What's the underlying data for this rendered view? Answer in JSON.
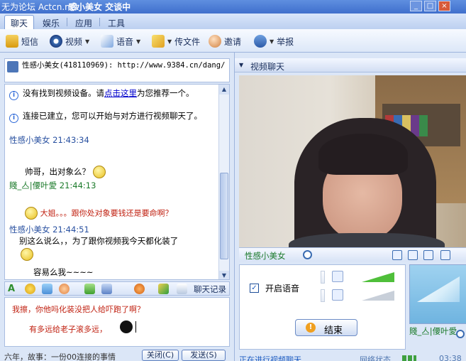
{
  "window": {
    "watermark": "无为论坛 Actcn.net",
    "title": "感小美女 交谈中",
    "controls": {
      "minimize": "_",
      "maximize": "□",
      "close": "×"
    }
  },
  "menu": {
    "tabs": [
      {
        "label": "聊天"
      },
      {
        "label": "娱乐"
      },
      {
        "label": "应用"
      },
      {
        "label": "工具"
      }
    ]
  },
  "toolbar": {
    "items": [
      {
        "label": "短信",
        "icon": "sms-icon"
      },
      {
        "label": "视频",
        "icon": "video-icon"
      },
      {
        "label": "语音",
        "icon": "voice-icon"
      },
      {
        "label": "传文件",
        "icon": "file-transfer-icon"
      },
      {
        "label": "邀请",
        "icon": "invite-icon"
      },
      {
        "label": "举报",
        "icon": "report-icon"
      }
    ]
  },
  "contact": {
    "title": "性感小美女(418110969): http://www.9384.cn/dang/"
  },
  "chat": {
    "sys1_prefix": "没有找到视频设备。请",
    "sys1_link": "点击这里",
    "sys1_suffix": "为您推荐一个。",
    "sys2": "连接已建立，您可以开始与对方进行视频聊天了。",
    "m1_sender": "性感小美女  21:43:34",
    "m1_text": "帅哥，出对象么？",
    "m2_sender": "賤_亼|偠叶愛  21:44:13",
    "m2_text": "大姐。。。跟你处对象要钱还是要命啊？",
    "m3_sender": "性感小美女  21:44:51",
    "m3_text": "别这么说么，，为了跟你视频我今天都化装了",
    "m4_text": "容易么我~~~~"
  },
  "format_bar": {
    "history_label": "聊天记录"
  },
  "input": {
    "line1": "我擦，你他吗化装没把人给吓跑了啊？",
    "line2": "有多远给老子滚多远，"
  },
  "bottom_left": {
    "status": "六年，故事：一份00连接的事情",
    "close_label": "关闭(C)",
    "send_label": "发送(S)"
  },
  "video_panel": {
    "header": "视频聊天",
    "peer_name": "性感小美女",
    "voice_label": "开启语音",
    "voice_checked": "✓",
    "end_label": "结束",
    "self_name": "賤_亼|偠叶愛"
  },
  "status_right": {
    "text": "正在进行视频聊天",
    "net_label": "网络状态",
    "timer": "03:38"
  },
  "colors": {
    "accent": "#3f6fcc",
    "panel": "#dbe6f7",
    "chat_red": "#c02010",
    "sender_blue": "#2850a0",
    "sender_green": "#1b7a2a"
  }
}
